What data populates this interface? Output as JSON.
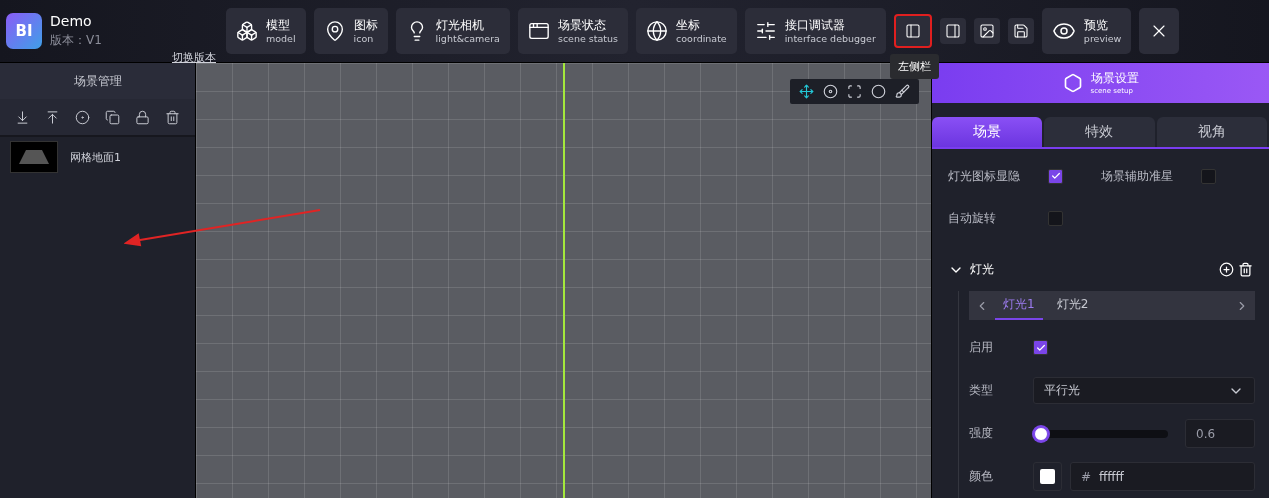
{
  "app": {
    "logo": "BI",
    "name": "Demo",
    "version": "版本：V1",
    "switch_link": "切换版本"
  },
  "toolbar": [
    {
      "kind": "labeled",
      "label": "模型",
      "sublabel": "model"
    },
    {
      "kind": "labeled",
      "label": "图标",
      "sublabel": "icon"
    },
    {
      "kind": "labeled",
      "label": "灯光相机",
      "sublabel": "light&camera"
    },
    {
      "kind": "labeled",
      "label": "场景状态",
      "sublabel": "scene status"
    },
    {
      "kind": "labeled",
      "label": "坐标",
      "sublabel": "coordinate"
    },
    {
      "kind": "labeled",
      "label": "接口调试器",
      "sublabel": "interface debugger"
    },
    {
      "kind": "icon",
      "highlighted": true,
      "tooltip": "左侧栏"
    },
    {
      "kind": "icon",
      "highlighted": false
    },
    {
      "kind": "icon",
      "highlighted": false
    },
    {
      "kind": "icon",
      "highlighted": false
    },
    {
      "kind": "labeled",
      "label": "预览",
      "sublabel": "preview"
    },
    {
      "kind": "close"
    }
  ],
  "left_panel": {
    "title": "场景管理",
    "items": [
      {
        "label": "网格地面1",
        "selected": false
      }
    ]
  },
  "viewport_tools": [
    {
      "selected": true
    },
    {
      "selected": false
    },
    {
      "selected": false
    },
    {
      "selected": false
    },
    {
      "selected": false
    }
  ],
  "right_panel": {
    "title": "场景设置",
    "subtitle": "scene setup",
    "tabs": [
      {
        "label": "场景",
        "selected": true
      },
      {
        "label": "特效",
        "selected": false
      },
      {
        "label": "视角",
        "selected": false
      }
    ],
    "options": [
      {
        "label": "灯光图标显隐",
        "checked": true
      },
      {
        "label": "场景辅助准星",
        "checked": false
      },
      {
        "label": "自动旋转",
        "checked": false
      }
    ],
    "section": {
      "title": "灯光",
      "expanded": true,
      "light_tabs": [
        {
          "label": "灯光1",
          "selected": true
        },
        {
          "label": "灯光2",
          "selected": false
        }
      ],
      "enable": {
        "label": "启用",
        "checked": true
      },
      "type": {
        "label": "类型",
        "value": "平行光"
      },
      "intensity": {
        "label": "强度",
        "level": 0,
        "value": "0.6"
      },
      "color": {
        "label": "颜色",
        "color": "#ffffff",
        "prefix": "#",
        "value": "ffffff"
      }
    }
  }
}
